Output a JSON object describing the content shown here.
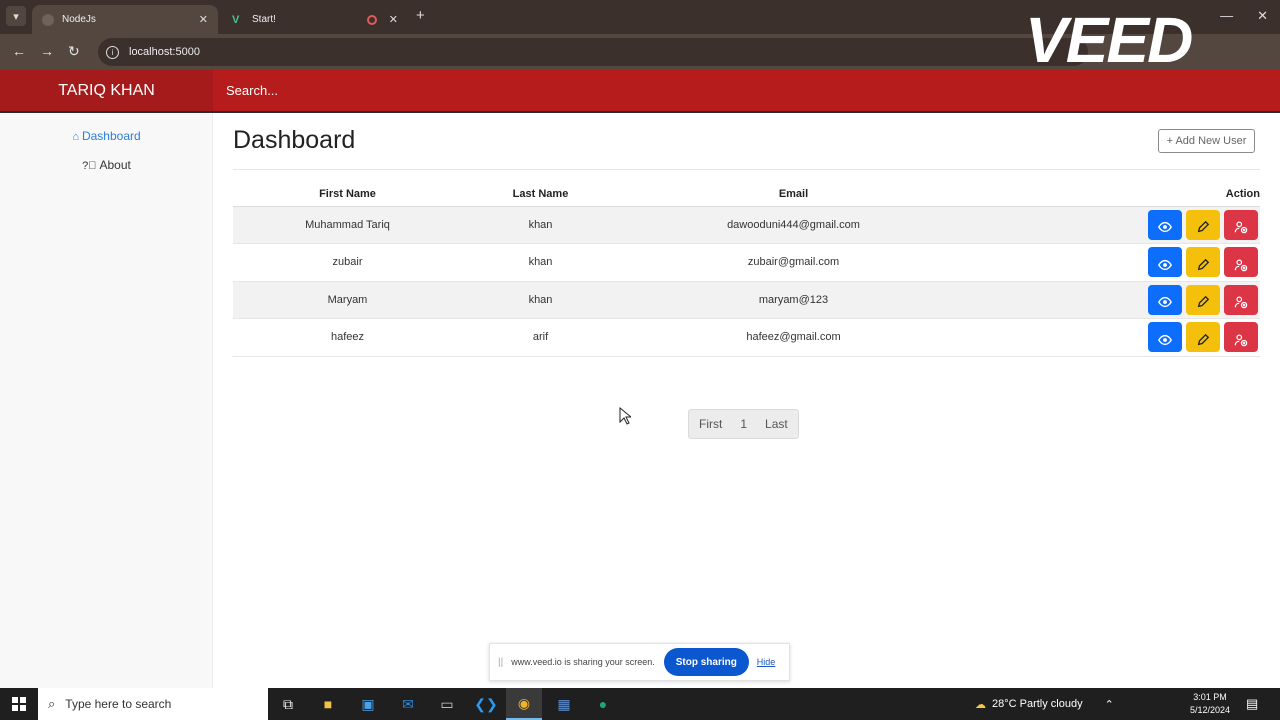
{
  "browser": {
    "tabs": [
      {
        "label": "NodeJs"
      },
      {
        "label": "Start!"
      }
    ],
    "url": "localhost:5000",
    "watermark": "VEED"
  },
  "app": {
    "brand": "TARIQ KHAN",
    "search_placeholder": "Search..."
  },
  "sidebar": {
    "items": [
      {
        "label": "Dashboard",
        "icon": "home-icon"
      },
      {
        "label": "About",
        "icon": "question-circle-icon"
      }
    ]
  },
  "main": {
    "title": "Dashboard",
    "add_button": "+ Add New User",
    "table": {
      "headers": [
        "First Name",
        "Last Name",
        "Email",
        "Action"
      ],
      "rows": [
        {
          "first": "Muhammad Tariq",
          "last": "khan",
          "email": "dawooduni444@gmail.com"
        },
        {
          "first": "zubair",
          "last": "khan",
          "email": "zubair@gmail.com"
        },
        {
          "first": "Maryam",
          "last": "khan",
          "email": "maryam@123"
        },
        {
          "first": "hafeez",
          "last": "arif",
          "email": "hafeez@gmail.com"
        }
      ]
    },
    "pagination": {
      "first": "First",
      "page": "1",
      "last": "Last"
    }
  },
  "share_bar": {
    "message": "www.veed.io is sharing your screen.",
    "stop": "Stop sharing",
    "hide": "Hide"
  },
  "taskbar": {
    "search_placeholder": "Type here to search",
    "weather": "28°C  Partly cloudy",
    "time": "3:01 PM",
    "date": "5/12/2024"
  },
  "colors": {
    "navbar": "#b71c1c",
    "view": "#0d6efd",
    "edit": "#f4c00b",
    "delete": "#dc3545"
  }
}
